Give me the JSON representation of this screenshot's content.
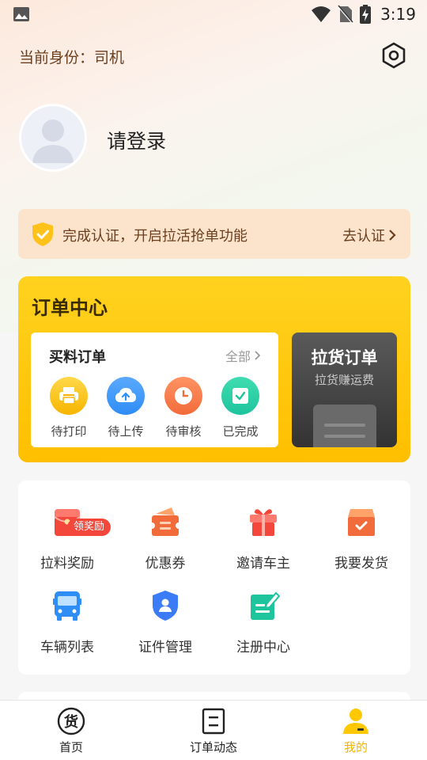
{
  "status_bar": {
    "time": "3:19"
  },
  "header": {
    "identity": "当前身份：司机"
  },
  "profile": {
    "login_prompt": "请登录"
  },
  "certification": {
    "message": "完成认证，开启拉活抢单功能",
    "action": "去认证"
  },
  "order_center": {
    "title": "订单中心",
    "material_orders": {
      "title": "买料订单",
      "all_link": "全部",
      "statuses": [
        {
          "label": "待打印",
          "icon": "printer-icon",
          "color": "#f7b500"
        },
        {
          "label": "待上传",
          "icon": "cloud-upload-icon",
          "color": "#2f8df6"
        },
        {
          "label": "待审核",
          "icon": "clock-icon",
          "color": "#f26b3a"
        },
        {
          "label": "已完成",
          "icon": "check-icon",
          "color": "#1ec49c"
        }
      ]
    },
    "haul_orders": {
      "title": "拉货订单",
      "subtitle": "拉货赚运费"
    }
  },
  "services": [
    {
      "label": "拉料奖励",
      "icon": "red-envelope-icon",
      "badge": "领奖励",
      "color": "#f2473a"
    },
    {
      "label": "优惠券",
      "icon": "coupon-icon",
      "color": "#f26b3a"
    },
    {
      "label": "邀请车主",
      "icon": "gift-icon",
      "color": "#f2473a"
    },
    {
      "label": "我要发货",
      "icon": "package-icon",
      "color": "#f26b3a"
    },
    {
      "label": "车辆列表",
      "icon": "bus-icon",
      "color": "#2f8df6"
    },
    {
      "label": "证件管理",
      "icon": "id-shield-icon",
      "color": "#3b7cf6"
    },
    {
      "label": "注册中心",
      "icon": "edit-note-icon",
      "color": "#1ec49c"
    }
  ],
  "tab_bar": {
    "tabs": [
      {
        "label": "首页",
        "icon": "home-logo-icon"
      },
      {
        "label": "订单动态",
        "icon": "order-list-icon"
      },
      {
        "label": "我的",
        "icon": "user-icon",
        "active": true
      }
    ]
  },
  "colors": {
    "accent": "#f2b400",
    "brand_yellow": "#ffc800",
    "text_brown": "#6b3f1e"
  }
}
